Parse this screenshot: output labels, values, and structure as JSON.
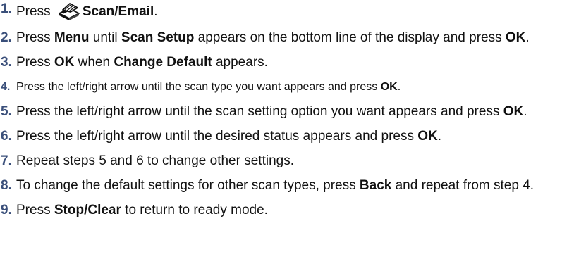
{
  "steps": [
    {
      "num": "1.",
      "pre": "Press ",
      "icon": "scan-email-icon",
      "bold1": "Scan/Email",
      "post": "."
    },
    {
      "num": "2.",
      "t1": "Press ",
      "b1": "Menu",
      "t2": " until ",
      "b2": "Scan Setup",
      "t3": " appears on the bottom line of the display and press ",
      "b3": "OK",
      "t4": "."
    },
    {
      "num": "3.",
      "t1": "Press ",
      "b1": "OK",
      "t2": " when ",
      "b2": "Change Default",
      "t3": " appears."
    },
    {
      "num": "4.",
      "t1": "Press the left/right arrow until the scan type you want appears and press ",
      "b1": "OK",
      "t2": "."
    },
    {
      "num": "5.",
      "t1": "Press the left/right arrow until the scan setting option you want appears and press ",
      "b1": "OK",
      "t2": "."
    },
    {
      "num": "6.",
      "t1": "Press the left/right arrow until the desired status appears and press ",
      "b1": "OK",
      "t2": "."
    },
    {
      "num": "7.",
      "t1": "Repeat steps 5 and 6 to change other settings."
    },
    {
      "num": "8.",
      "t1": "To change the default settings for other scan types, press ",
      "b1": "Back",
      "t2": " and repeat from step 4."
    },
    {
      "num": "9.",
      "t1": "Press ",
      "b1": "Stop/Clear",
      "t2": " to return to ready mode."
    }
  ]
}
